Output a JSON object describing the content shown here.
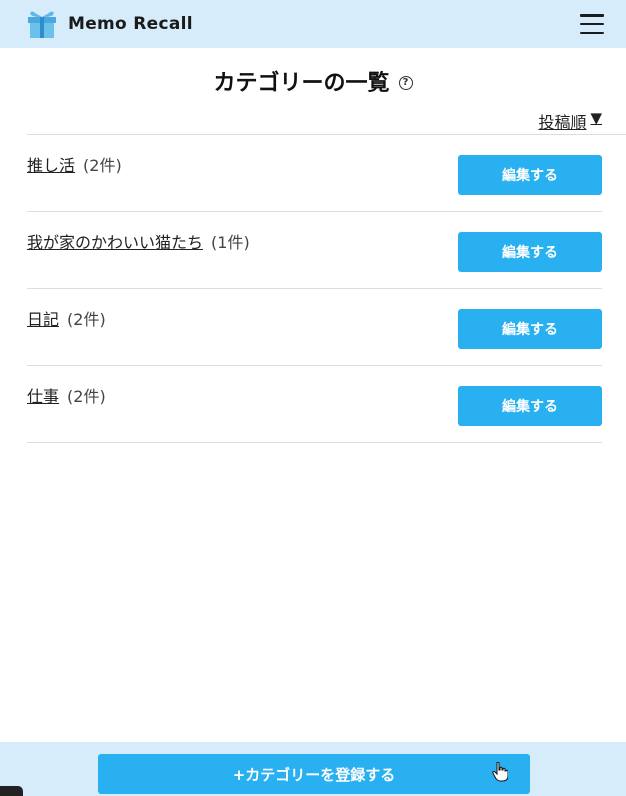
{
  "app": {
    "name": "Memo Recall",
    "icons": {
      "logo": "gift-icon",
      "menu": "hamburger-menu-icon",
      "help": "question-circle-icon"
    },
    "colors": {
      "header_bg": "#d6ecfb",
      "accent": "#29b0f0"
    }
  },
  "page": {
    "title": "カテゴリーの一覧",
    "help_glyph": "?",
    "sort_label": "投稿順",
    "sort_arrow": "▼"
  },
  "categories": [
    {
      "name": "推し活",
      "count": "(2件)",
      "edit_label": "編集する"
    },
    {
      "name": "我が家のかわいい猫たち",
      "count": "(1件)",
      "edit_label": "編集する"
    },
    {
      "name": "日記",
      "count": "(2件)",
      "edit_label": "編集する"
    },
    {
      "name": "仕事",
      "count": "(2件)",
      "edit_label": "編集する"
    }
  ],
  "footer": {
    "register_label": "+カテゴリーを登録する"
  }
}
